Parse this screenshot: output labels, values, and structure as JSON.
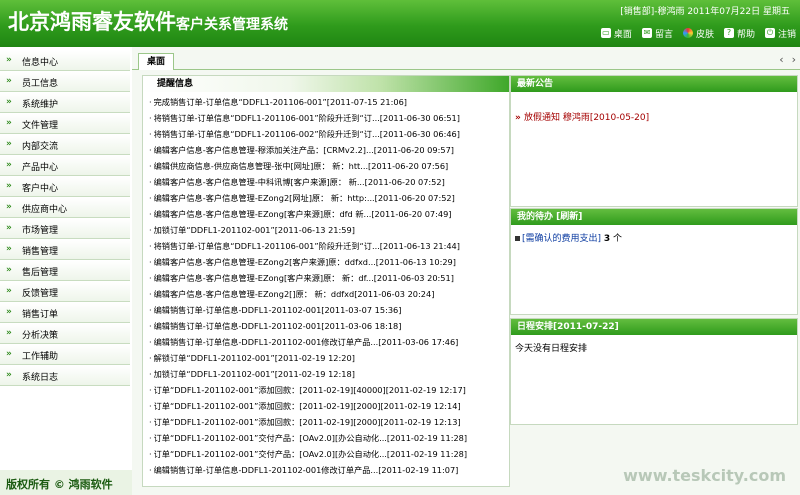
{
  "header": {
    "title_main": "北京鸿雨睿友软件",
    "title_sub": "客户关系管理系统",
    "user_info": "[销售部]-穆鸿雨  2011年07月22日 星期五",
    "toolbar": {
      "desktop": "桌面",
      "message": "留言",
      "skin": "皮肤",
      "help": "帮助",
      "logout": "注销"
    }
  },
  "sidebar": {
    "items": [
      {
        "label": "信息中心"
      },
      {
        "label": "员工信息"
      },
      {
        "label": "系统维护"
      },
      {
        "label": "文件管理"
      },
      {
        "label": "内部交流"
      },
      {
        "label": "产品中心"
      },
      {
        "label": "客户中心"
      },
      {
        "label": "供应商中心"
      },
      {
        "label": "市场管理"
      },
      {
        "label": "销售管理"
      },
      {
        "label": "售后管理"
      },
      {
        "label": "反馈管理"
      },
      {
        "label": "销售订单"
      },
      {
        "label": "分析决策"
      },
      {
        "label": "工作辅助"
      },
      {
        "label": "系统日志"
      }
    ],
    "copyright": "版权所有 © 鸿雨软件"
  },
  "tabs": {
    "desktop": "桌面",
    "prev": "‹",
    "next": "›"
  },
  "reminders": {
    "title": "提醒信息",
    "items": [
      {
        "text": "完成销售订单-订单信息“DDFL1-201106-001”[2011-07-15 21:06]"
      },
      {
        "text": "将销售订单-订单信息“DDFL1-201106-001”阶段升迁到“订...[2011-06-30 06:51]"
      },
      {
        "text": "将销售订单-订单信息“DDFL1-201106-002”阶段升迁到“订...[2011-06-30 06:46]"
      },
      {
        "text": "编辑客户信息-客户信息管理-穆添加关注产品：[CRMv2.2]...[2011-06-20 09:57]"
      },
      {
        "text": "编辑供应商信息-供应商信息管理-张中[网址]原：  新：htt...[2011-06-20 07:56]"
      },
      {
        "text": "编辑客户信息-客户信息管理-中科讯博[客户来源]原：  新...[2011-06-20 07:52]"
      },
      {
        "text": "编辑客户信息-客户信息管理-EZong2[网址]原：  新：http:...[2011-06-20 07:52]"
      },
      {
        "text": "编辑客户信息-客户信息管理-EZong[客户来源]原：dfd  新...[2011-06-20 07:49]"
      },
      {
        "text": "加锁订单“DDFL1-201102-001”[2011-06-13 21:59]"
      },
      {
        "text": "将销售订单-订单信息“DDFL1-201106-001”阶段升迁到“订...[2011-06-13 21:44]"
      },
      {
        "text": "编辑客户信息-客户信息管理-EZong2[客户来源]原：ddfxd...[2011-06-13 10:29]"
      },
      {
        "text": "编辑客户信息-客户信息管理-EZong[客户来源]原：  新：df...[2011-06-03 20:51]"
      },
      {
        "text": "编辑客户信息-客户信息管理-EZong2[]原：  新：ddfxd[2011-06-03 20:24]"
      },
      {
        "text": "编辑销售订单-订单信息-DDFL1-201102-001[2011-03-07 15:36]"
      },
      {
        "text": "编辑销售订单-订单信息-DDFL1-201102-001[2011-03-06 18:18]"
      },
      {
        "text": "编辑销售订单-订单信息-DDFL1-201102-001修改订单产品...[2011-03-06 17:46]"
      },
      {
        "text": "解锁订单“DDFL1-201102-001”[2011-02-19 12:20]"
      },
      {
        "text": "加锁订单“DDFL1-201102-001”[2011-02-19 12:18]"
      },
      {
        "text": "订单“DDFL1-201102-001”添加回款：[2011-02-19][40000][2011-02-19 12:17]"
      },
      {
        "text": "订单“DDFL1-201102-001”添加回款：[2011-02-19][2000][2011-02-19 12:14]"
      },
      {
        "text": "订单“DDFL1-201102-001”添加回款：[2011-02-19][2000][2011-02-19 12:13]"
      },
      {
        "text": "订单“DDFL1-201102-001”交付产品：[OAv2.0][办公自动化...[2011-02-19 11:28]"
      },
      {
        "text": "订单“DDFL1-201102-001”交付产品：[OAv2.0][办公自动化...[2011-02-19 11:28]"
      },
      {
        "text": "编辑销售订单-订单信息-DDFL1-201102-001修改订单产品...[2011-02-19 11:07]"
      }
    ]
  },
  "announcements": {
    "title": "最新公告",
    "item": "放假通知 穆鸿雨[2010-05-20]"
  },
  "todo": {
    "title": "我的待办 [刷新]",
    "link": "[需确认的费用支出]",
    "count": "3",
    "unit": "个"
  },
  "schedule": {
    "title": "日程安排[2011-07-22]",
    "empty": "今天没有日程安排"
  },
  "watermark": "www.teskcity.com"
}
